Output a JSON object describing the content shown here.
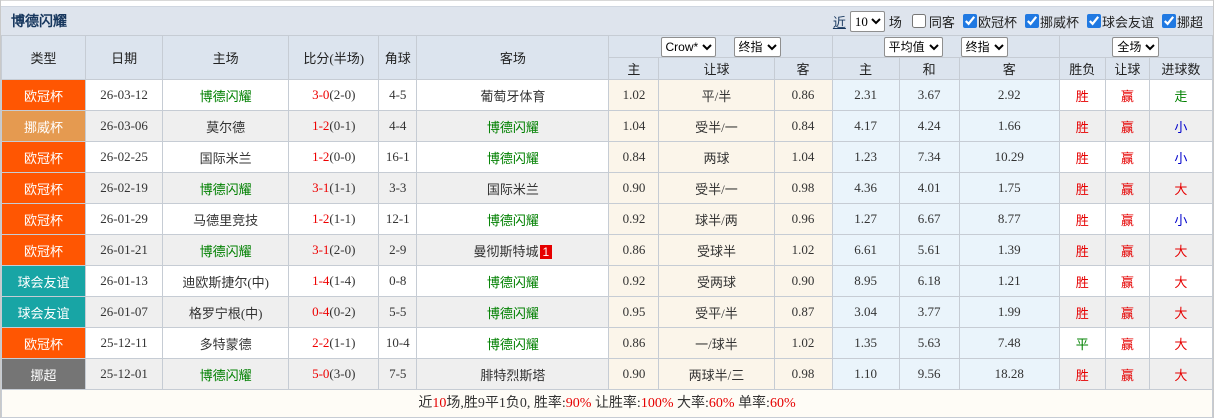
{
  "header_bar": {
    "title": "博德闪耀",
    "recent": {
      "label_prefix": "近",
      "value": "10",
      "label_suffix": "场"
    },
    "same_away": {
      "label": "同客",
      "checked": false
    },
    "competitions": [
      {
        "label": "欧冠杯",
        "checked": true
      },
      {
        "label": "挪威杯",
        "checked": true
      },
      {
        "label": "球会友谊",
        "checked": true
      },
      {
        "label": "挪超",
        "checked": true
      }
    ]
  },
  "table": {
    "headers": {
      "type": "类型",
      "date": "日期",
      "home": "主场",
      "score": "比分(半场)",
      "corner": "角球",
      "away": "客场",
      "sub": {
        "hcap_home": "主",
        "hcap_line": "让球",
        "hcap_away": "客",
        "euro_home": "主",
        "euro_draw": "和",
        "euro_away": "客",
        "outcome": "胜负",
        "hcap_result": "让球",
        "goals_result": "进球数"
      }
    },
    "dropdowns": {
      "hcap_source": "Crow*",
      "hcap_time": "终指",
      "euro_source": "平均值",
      "euro_time": "终指",
      "result_scope": "全场"
    },
    "type_colors": {
      "欧冠杯": "#ff5602",
      "挪威杯": "#e59a50",
      "球会友谊": "#18a5a5",
      "挪超": "#757575"
    },
    "result_colors": {
      "胜": "#e60000",
      "平": "#008000",
      "负": "#0000cc",
      "赢": "#e60000",
      "输": "#008000",
      "走": "#008000",
      "大": "#e60000",
      "小": "#0000cc"
    },
    "rows": [
      {
        "type": "欧冠杯",
        "date": "26-03-12",
        "home": "博德闪耀",
        "score": "3-0",
        "half": "(2-0)",
        "corner": "4-5",
        "away": "葡萄牙体育",
        "hcap_home": "1.02",
        "hcap_line": "平/半",
        "hcap_away": "0.86",
        "euro_home": "2.31",
        "euro_draw": "3.67",
        "euro_away": "2.92",
        "outcome": "胜",
        "hcap_result": "赢",
        "goals_result": "走"
      },
      {
        "type": "挪威杯",
        "date": "26-03-06",
        "home": "莫尔德",
        "score": "1-2",
        "half": "(0-1)",
        "corner": "4-4",
        "away": "博德闪耀",
        "hcap_home": "1.04",
        "hcap_line": "受半/一",
        "hcap_away": "0.84",
        "euro_home": "4.17",
        "euro_draw": "4.24",
        "euro_away": "1.66",
        "outcome": "胜",
        "hcap_result": "赢",
        "goals_result": "小"
      },
      {
        "type": "欧冠杯",
        "date": "26-02-25",
        "home": "国际米兰",
        "score": "1-2",
        "half": "(0-0)",
        "corner": "16-1",
        "away": "博德闪耀",
        "hcap_home": "0.84",
        "hcap_line": "两球",
        "hcap_away": "1.04",
        "euro_home": "1.23",
        "euro_draw": "7.34",
        "euro_away": "10.29",
        "outcome": "胜",
        "hcap_result": "赢",
        "goals_result": "小"
      },
      {
        "type": "欧冠杯",
        "date": "26-02-19",
        "home": "博德闪耀",
        "score": "3-1",
        "half": "(1-1)",
        "corner": "3-3",
        "away": "国际米兰",
        "hcap_home": "0.90",
        "hcap_line": "受半/一",
        "hcap_away": "0.98",
        "euro_home": "4.36",
        "euro_draw": "4.01",
        "euro_away": "1.75",
        "outcome": "胜",
        "hcap_result": "赢",
        "goals_result": "大"
      },
      {
        "type": "欧冠杯",
        "date": "26-01-29",
        "home": "马德里竞技",
        "score": "1-2",
        "half": "(1-1)",
        "corner": "12-1",
        "away": "博德闪耀",
        "hcap_home": "0.92",
        "hcap_line": "球半/两",
        "hcap_away": "0.96",
        "euro_home": "1.27",
        "euro_draw": "6.67",
        "euro_away": "8.77",
        "outcome": "胜",
        "hcap_result": "赢",
        "goals_result": "小"
      },
      {
        "type": "欧冠杯",
        "date": "26-01-21",
        "home": "博德闪耀",
        "score": "3-1",
        "half": "(2-0)",
        "corner": "2-9",
        "away": "曼彻斯特城",
        "away_badge": "1",
        "hcap_home": "0.86",
        "hcap_line": "受球半",
        "hcap_away": "1.02",
        "euro_home": "6.61",
        "euro_draw": "5.61",
        "euro_away": "1.39",
        "outcome": "胜",
        "hcap_result": "赢",
        "goals_result": "大"
      },
      {
        "type": "球会友谊",
        "date": "26-01-13",
        "home": "迪欧斯捷尔(中)",
        "score": "1-4",
        "half": "(1-4)",
        "corner": "0-8",
        "away": "博德闪耀",
        "hcap_home": "0.92",
        "hcap_line": "受两球",
        "hcap_away": "0.90",
        "euro_home": "8.95",
        "euro_draw": "6.18",
        "euro_away": "1.21",
        "outcome": "胜",
        "hcap_result": "赢",
        "goals_result": "大"
      },
      {
        "type": "球会友谊",
        "date": "26-01-07",
        "home": "格罗宁根(中)",
        "score": "0-4",
        "half": "(0-2)",
        "corner": "5-5",
        "away": "博德闪耀",
        "hcap_home": "0.95",
        "hcap_line": "受平/半",
        "hcap_away": "0.87",
        "euro_home": "3.04",
        "euro_draw": "3.77",
        "euro_away": "1.99",
        "outcome": "胜",
        "hcap_result": "赢",
        "goals_result": "大"
      },
      {
        "type": "欧冠杯",
        "date": "25-12-11",
        "home": "多特蒙德",
        "score": "2-2",
        "half": "(1-1)",
        "corner": "10-4",
        "away": "博德闪耀",
        "hcap_home": "0.86",
        "hcap_line": "一/球半",
        "hcap_away": "1.02",
        "euro_home": "1.35",
        "euro_draw": "5.63",
        "euro_away": "7.48",
        "outcome": "平",
        "hcap_result": "赢",
        "goals_result": "大"
      },
      {
        "type": "挪超",
        "date": "25-12-01",
        "home": "博德闪耀",
        "score": "5-0",
        "half": "(3-0)",
        "corner": "7-5",
        "away": "腓特烈斯塔",
        "hcap_home": "0.90",
        "hcap_line": "两球半/三",
        "hcap_away": "0.98",
        "euro_home": "1.10",
        "euro_draw": "9.56",
        "euro_away": "18.28",
        "outcome": "胜",
        "hcap_result": "赢",
        "goals_result": "大"
      }
    ]
  },
  "summary": {
    "segments": [
      {
        "text": "近",
        "red": false
      },
      {
        "text": "10",
        "red": true
      },
      {
        "text": "场,胜9平1负0, 胜率:",
        "red": false
      },
      {
        "text": "90%",
        "red": true
      },
      {
        "text": " 让胜率:",
        "red": false
      },
      {
        "text": "100%",
        "red": true
      },
      {
        "text": " 大率:",
        "red": false
      },
      {
        "text": "60%",
        "red": true
      },
      {
        "text": " 单率:",
        "red": false
      },
      {
        "text": "60%",
        "red": true
      }
    ]
  }
}
